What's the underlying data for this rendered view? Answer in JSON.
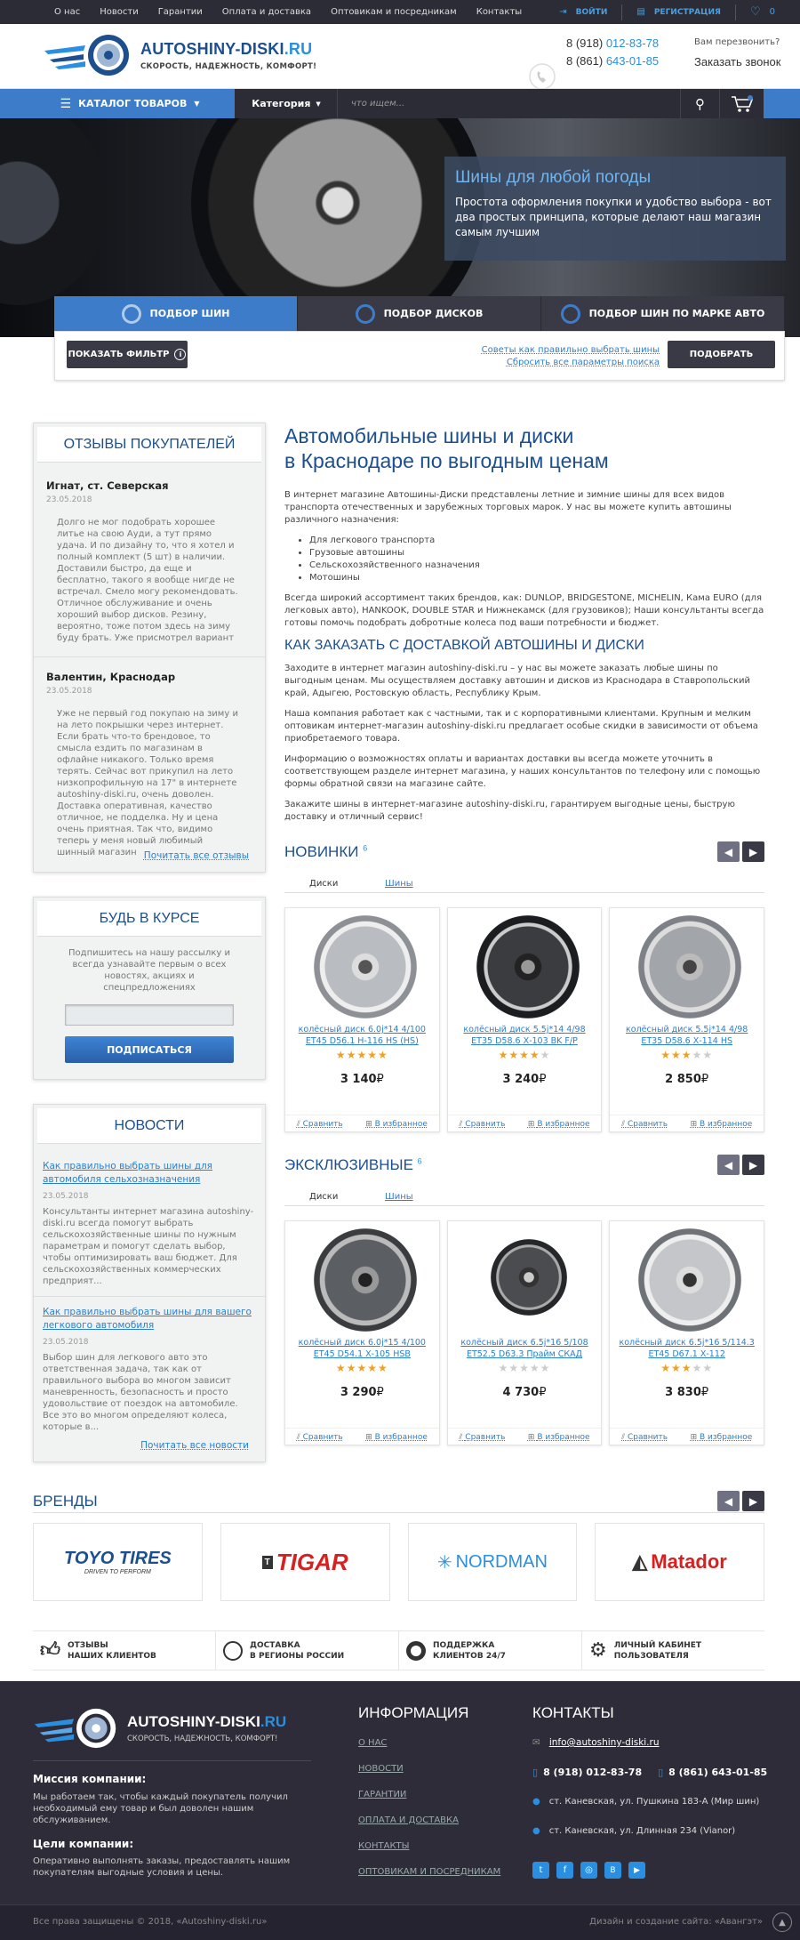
{
  "topbar": {
    "menu": [
      "О нас",
      "Новости",
      "Гарантии",
      "Оплата и доставка",
      "Оптовикам и посредникам",
      "Контакты"
    ],
    "login": "ВОЙТИ",
    "register": "РЕГИСТРАЦИЯ",
    "favorites_count": "0"
  },
  "header": {
    "logo_name": "AUTOSHINY-DISKI",
    "logo_tld": ".RU",
    "slogan": "СКОРОСТЬ, НАДЕЖНОСТЬ, КОМФОРТ!",
    "phone1_prefix": "8 (918) ",
    "phone1_num": "012-83-78",
    "phone2_prefix": "8 (861) ",
    "phone2_num": "643-01-85",
    "callback_q": "Вам перезвонить?",
    "callback_btn": "Заказать звонок"
  },
  "nav": {
    "catalog": "КАТАЛОГ ТОВАРОВ",
    "category": "Категория",
    "search_placeholder": "что ищем..."
  },
  "hero": {
    "title": "Шины для любой погоды",
    "text": "Простота оформления покупки и удобство выбора - вот два простых принципа, которые делают наш магазин самым лучшим"
  },
  "selector": {
    "tabs": [
      "ПОДБОР ШИН",
      "ПОДБОР ДИСКОВ",
      "ПОДБОР ШИН ПО МАРКЕ АВТО"
    ],
    "show_filter": "ПОКАЗАТЬ ФИЛЬТР",
    "link_advice": "Советы как правильно выбрать шины",
    "link_reset": "Сбросить все параметры поиска",
    "submit": "ПОДОБРАТЬ"
  },
  "reviews": {
    "title": "ОТЗЫВЫ ПОКУПАТЕЛЕЙ",
    "items": [
      {
        "name": "Игнат, ст. Северская",
        "date": "23.05.2018",
        "text": "Долго не мог подобрать хорошее литье на свою Ауди, а тут прямо удача. И по дизайну то, что я хотел и полный комплект (5 шт) в наличии. Доставили быстро, да еще и бесплатно, такого я вообще нигде не встречал. Смело могу рекомендовать. Отличное обслуживание и очень хороший выбор дисков. Резину, вероятно, тоже потом здесь на зиму буду брать. Уже присмотрел вариант"
      },
      {
        "name": "Валентин, Краснодар",
        "date": "23.05.2018",
        "text": "Уже не первый год покупаю на зиму и на лето покрышки через интернет. Если брать что-то брендовое, то смысла ездить по магазинам в офлайне никакого. Только время терять. Сейчас вот прикупил на лето низкопрофильную на 17\" в интернете autoshiny-diski.ru, очень доволен. Доставка оперативная, качество отличное, не подделка. Ну и цена очень приятная. Так что, видимо теперь у меня новый любимый шинный магазин"
      }
    ],
    "read_all": "Почитать все отзывы"
  },
  "subscribe": {
    "title": "БУДЬ В КУРСЕ",
    "text": "Подпишитесь на нашу рассылку и всегда узнавайте первым о всех новостях, акциях и спецпредложениях",
    "button": "ПОДПИСАТЬСЯ"
  },
  "news": {
    "title": "НОВОСТИ",
    "items": [
      {
        "title": "Как правильно выбрать шины для автомобиля сельхозназначения",
        "date": "23.05.2018",
        "text": "Консультанты интернет магазина autoshiny-diski.ru всегда помогут выбрать сельскохозяйственные шины по нужным параметрам и помогут сделать выбор, чтобы оптимизировать ваш бюджет. Для сельскохозяйственных коммерческих предприят..."
      },
      {
        "title": "Как правильно выбрать шины для вашего легкового автомобиля",
        "date": "23.05.2018",
        "text": "Выбор шин для легкового авто это ответственная задача, так как от правильного выбора во многом зависит маневренность, безопасность и просто удовольствие от поездок на автомобиле. Все это во многом определяют колеса, которые в..."
      }
    ],
    "read_all": "Почитать все новости"
  },
  "article": {
    "h1_line1": "Автомобильные шины и диски",
    "h1_line2": "в Краснодаре по выгодным ценам",
    "p1": "В интернет магазине Автошины-Диски представлены летние и зимние шины для всех видов транспорта отечественных и зарубежных торговых марок. У нас вы можете купить автошины различного назначения:",
    "list": [
      "Для легкового транспорта",
      "Грузовые автошины",
      "Сельскохозяйственного назначения",
      "Мотошины"
    ],
    "p2": "Всегда широкий ассортимент таких брендов, как: DUNLOP, BRIDGESTONE, MICHELIN, Кама EURO (для легковых авто), HANKOOK, DOUBLE STAR и Нижнекамск (для грузовиков); Наши консультанты всегда готовы помочь подобрать добротные колеса под ваши потребности и бюджет.",
    "h2": "КАК ЗАКАЗАТЬ С ДОСТАВКОЙ АВТОШИНЫ И ДИСКИ",
    "p3": "Заходите в интернет магазин autoshiny-diski.ru – у нас вы можете заказать любые шины по выгодным ценам. Мы осуществляем доставку автошин и дисков из Краснодара в Ставропольский край, Адыгею, Ростовскую область, Республику Крым.",
    "p4": "Наша компания работает как с частными, так и с корпоративными клиентами. Крупным и мелким оптовикам интернет-магазин autoshiny-diski.ru предлагает особые скидки в зависимости от объема приобретаемого товара.",
    "p5": "Информацию о возможностях оплаты и вариантах доставки вы всегда можете уточнить в соответствующем разделе интернет магазина, у наших консультантов по телефону или с помощью формы обратной связи на магазине сайте.",
    "p6": "Закажите шины в интернет-магазине autoshiny-diski.ru, гарантируем выгодные цены, быструю доставку и отличный сервис!"
  },
  "new_products": {
    "title": "НОВИНКИ",
    "count": "6",
    "tabs": [
      "Диски",
      "Шины"
    ],
    "items": [
      {
        "name": "колёсный диск 6.0j*14 4/100 ET45 D56.1 Н-116 HS (HS)",
        "price": "3 140",
        "rating": 5
      },
      {
        "name": "колёсный диск 5.5j*14 4/98 ET35 D58.6 Х-103 BK F/P",
        "price": "3 240",
        "rating": 4
      },
      {
        "name": "колёсный диск 5.5j*14 4/98 ET35 D58.6 Х-114 HS",
        "price": "2 850",
        "rating": 3
      }
    ]
  },
  "exclusive_products": {
    "title": "ЭКСКЛЮЗИВНЫЕ",
    "count": "6",
    "tabs": [
      "Диски",
      "Шины"
    ],
    "items": [
      {
        "name": "колёсный диск 6.0j*15 4/100 ET45 D54.1 Х-105 HSB",
        "price": "3 290",
        "rating": 5
      },
      {
        "name": "колёсный диск 6.5j*16 5/108 ET52.5 D63.3 Прайм СКАД",
        "price": "4 730",
        "rating": 0
      },
      {
        "name": "колёсный диск 6.5j*16 5/114.3 ET45 D67.1 Х-112",
        "price": "3 830",
        "rating": 3
      }
    ]
  },
  "product_actions": {
    "compare": "Сравнить",
    "favorite": "В избранное",
    "currency": "₽"
  },
  "brands": {
    "title": "БРЕНДЫ",
    "items": [
      "TOYO TIRES",
      "TIGAR",
      "NORDMAN",
      "Matador"
    ],
    "toyo_sub": "DRIVEN TO PERFORM"
  },
  "features": [
    {
      "l1": "ОТЗЫВЫ",
      "l2": "НАШИХ КЛИЕНТОВ"
    },
    {
      "l1": "ДОСТАВКА",
      "l2": "В РЕГИОНЫ РОССИИ"
    },
    {
      "l1": "ПОДДЕРЖКА",
      "l2": "КЛИЕНТОВ 24/7"
    },
    {
      "l1": "ЛИЧНЫЙ КАБИНЕТ",
      "l2": "ПОЛЬЗОВАТЕЛЯ"
    }
  ],
  "footer": {
    "mission_title": "Миссия компании:",
    "mission": "Мы работаем так, чтобы каждый покупатель получил необходимый ему товар и был доволен нашим обслуживанием.",
    "goals_title": "Цели компании:",
    "goals": "Оперативно выполнять заказы, предоставлять нашим покупателям выгодные условия и цены.",
    "info_title": "ИНФОРМАЦИЯ",
    "info_links": [
      "О НАС",
      "НОВОСТИ",
      "ГАРАНТИИ",
      "ОПЛАТА И ДОСТАВКА",
      "КОНТАКТЫ",
      "ОПТОВИКАМ И ПОСРЕДНИКАМ"
    ],
    "contacts_title": "КОНТАКТЫ",
    "email": "info@autoshiny-diski.ru",
    "phone1": "8 (918) 012-83-78",
    "phone2": "8 (861) 643-01-85",
    "addr1": "ст. Каневская, ул. Пушкина 183-А (Мир шин)",
    "addr2": "ст. Каневская, ул. Длинная 234 (Vianor)",
    "copyright": "Все права защищены © 2018, «Autoshiny-diski.ru»",
    "credits": "Дизайн и создание сайта: «Авангэт»"
  },
  "colors": {
    "brand_blue": "#3d7cc9",
    "dark": "#2c2c36",
    "link": "#2a7fd0",
    "star": "#f0a020"
  }
}
